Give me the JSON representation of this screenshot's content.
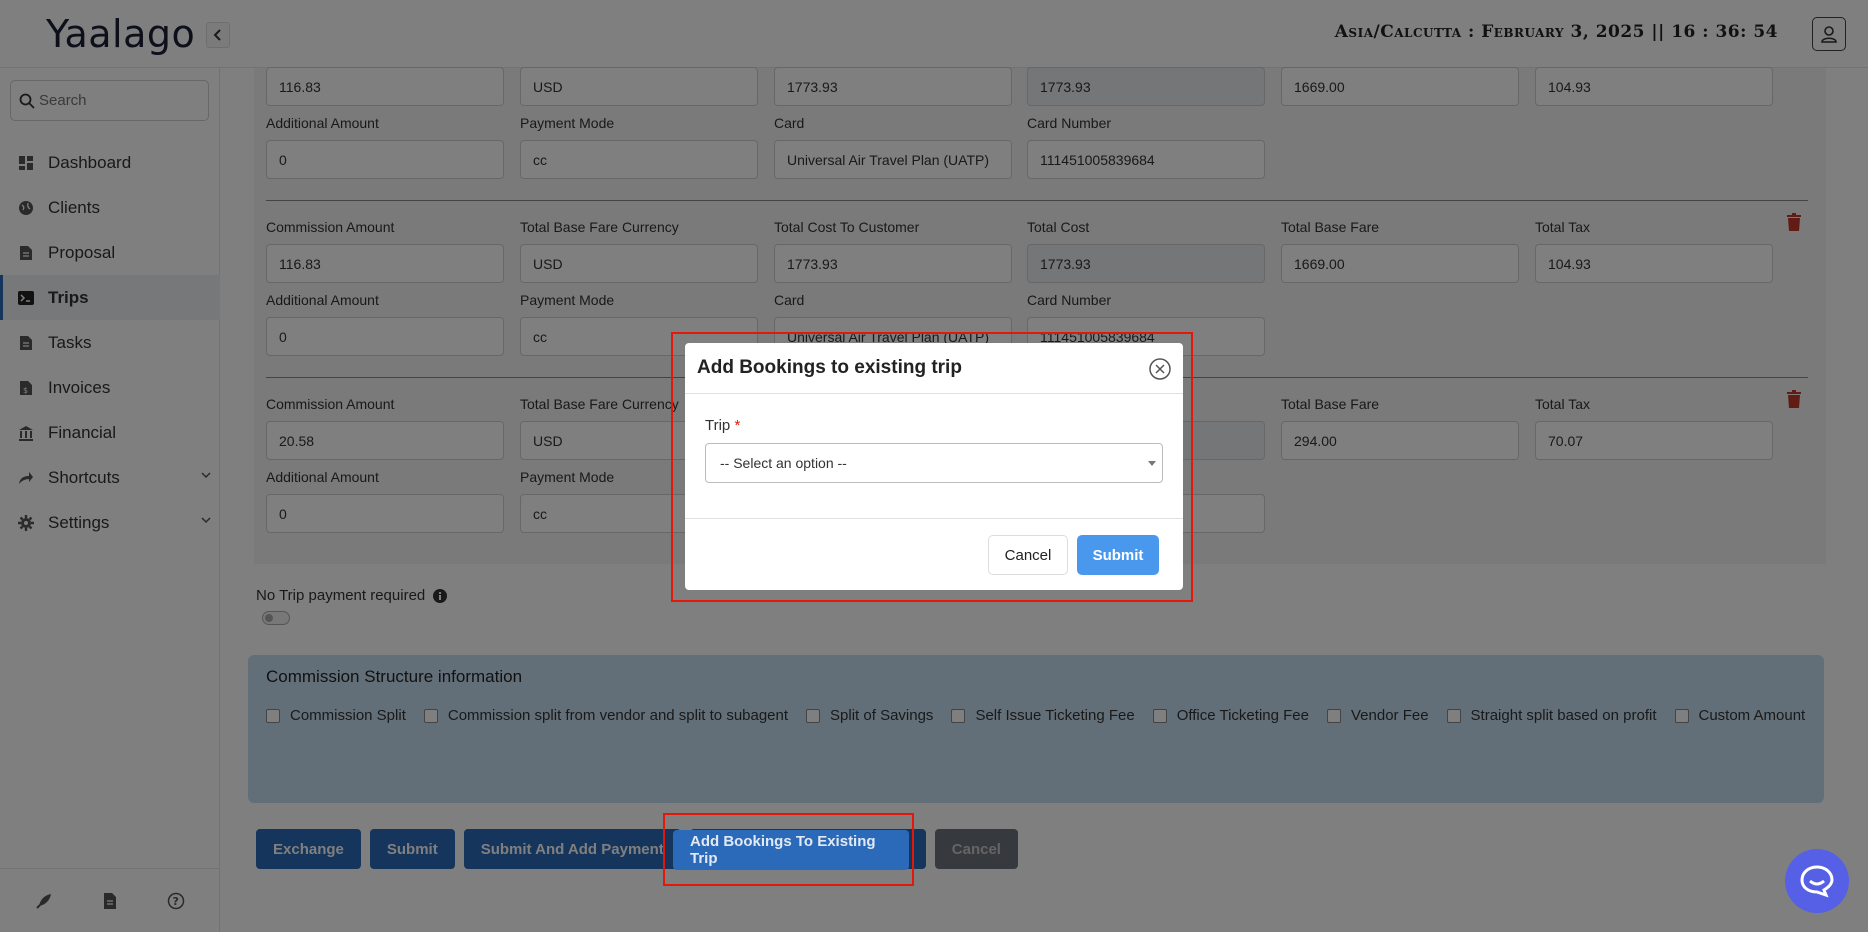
{
  "header": {
    "logo": "Yaalago",
    "clock": "Asia/Calcutta : February 3, 2025 || 16 : 36: 54"
  },
  "sidebar": {
    "search_placeholder": "Search",
    "items": [
      {
        "label": "Dashboard",
        "icon": "dashboard-icon"
      },
      {
        "label": "Clients",
        "icon": "globe-icon"
      },
      {
        "label": "Proposal",
        "icon": "document-icon"
      },
      {
        "label": "Trips",
        "icon": "terminal-icon",
        "active": true
      },
      {
        "label": "Tasks",
        "icon": "document-icon"
      },
      {
        "label": "Invoices",
        "icon": "invoice-icon"
      },
      {
        "label": "Financial",
        "icon": "bank-icon"
      },
      {
        "label": "Shortcuts",
        "icon": "share-icon",
        "expandable": true
      },
      {
        "label": "Settings",
        "icon": "gear-icon",
        "expandable": true
      }
    ],
    "footer_icons": [
      "rocket-icon",
      "file-icon",
      "help-icon"
    ]
  },
  "bookings": [
    {
      "show_header_labels": false,
      "commission_amount": "116.83",
      "base_fare_currency": "USD",
      "total_cost_to_customer": "1773.93",
      "total_cost": "1773.93",
      "total_base_fare": "1669.00",
      "total_tax": "104.93",
      "additional_amount": "0",
      "payment_mode": "cc",
      "card": "Universal Air Travel Plan (UATP)",
      "card_number": "111451005839684"
    },
    {
      "commission_amount": "116.83",
      "base_fare_currency": "USD",
      "total_cost_to_customer": "1773.93",
      "total_cost": "1773.93",
      "total_base_fare": "1669.00",
      "total_tax": "104.93",
      "additional_amount": "0",
      "payment_mode": "cc",
      "card": "Universal Air Travel Plan (UATP)",
      "card_number": "111451005839684"
    },
    {
      "commission_amount": "20.58",
      "base_fare_currency": "USD",
      "total_base_fare": "294.00",
      "total_tax": "70.07",
      "additional_amount": "0",
      "payment_mode": "cc"
    }
  ],
  "labels": {
    "commission_amount": "Commission Amount",
    "base_fare_currency": "Total Base Fare Currency",
    "total_cost_to_customer": "Total Cost To Customer",
    "total_cost": "Total Cost",
    "total_base_fare": "Total Base Fare",
    "total_tax": "Total Tax",
    "additional_amount": "Additional Amount",
    "payment_mode": "Payment Mode",
    "card": "Card",
    "card_number": "Card Number"
  },
  "no_trip_payment": "No Trip payment required",
  "commission_structure": {
    "title": "Commission Structure information",
    "options": [
      "Commission Split",
      "Commission split from vendor and split to subagent",
      "Split of Savings",
      "Self Issue Ticketing Fee",
      "Office Ticketing Fee",
      "Vendor Fee",
      "Straight split based on profit",
      "Custom Amount"
    ]
  },
  "actions": {
    "exchange": "Exchange",
    "submit": "Submit",
    "submit_and_add_payment": "Submit And Add Payment",
    "add_bookings": "Add Bookings To Existing Trip",
    "cancel": "Cancel"
  },
  "modal": {
    "title": "Add Bookings to existing trip",
    "trip_label": "Trip",
    "required_mark": "*",
    "select_value": "-- Select an option --",
    "cancel": "Cancel",
    "submit": "Submit"
  },
  "colors": {
    "primary": "#2a6ab8",
    "modal_submit": "#4a97ee",
    "highlight": "#e3170a",
    "chat": "#5560e6"
  }
}
